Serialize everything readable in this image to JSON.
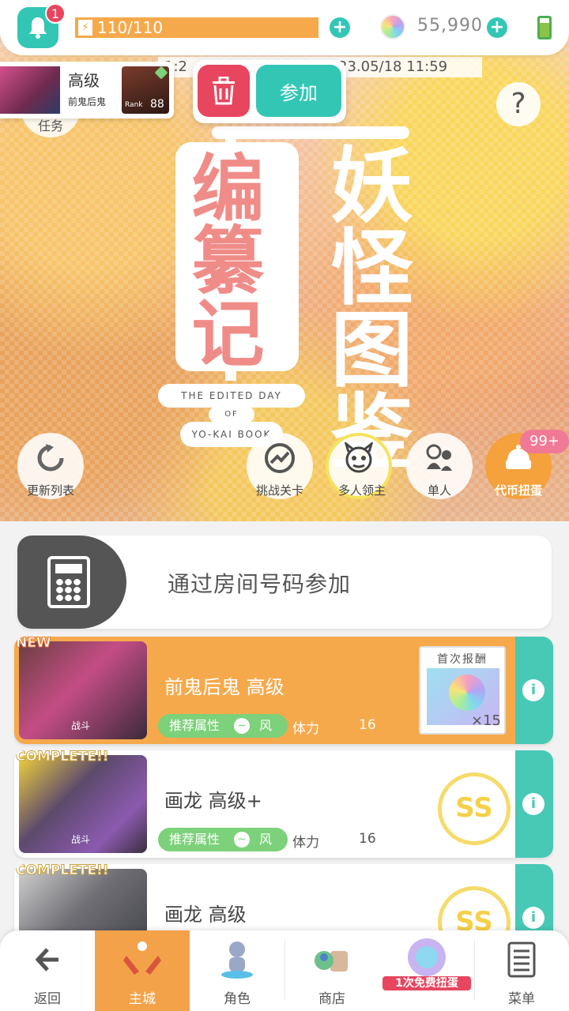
{
  "app": {
    "notifications": {
      "count": "1"
    },
    "stamina": {
      "text": "110/110"
    },
    "currency": {
      "amount": "55,990"
    },
    "ticker": {
      "left": "1:2",
      "right": "23.05/18 11:59"
    }
  },
  "quest_popup": {
    "title": "高级",
    "subtitle": "前鬼后鬼",
    "rank_label": "Rank",
    "rank": "88",
    "join_label": "参加"
  },
  "task": {
    "label": "任务"
  },
  "logo": {
    "left_chars": "编纂记",
    "right_chars": "妖怪图鉴",
    "en_line1": "THE EDITED DAY",
    "en_line2": "OF",
    "en_line3": "YO-KAI BOOK"
  },
  "modes": {
    "refresh": "更新列表",
    "challenge": "挑战关卡",
    "multi_boss": "多人领主",
    "solo": "单人",
    "gacha": "代币扭蛋",
    "gacha_badge": "99+"
  },
  "room_code": {
    "label": "通过房间号码参加"
  },
  "quests": [
    {
      "flag": "NEW",
      "thumb_label": "战斗",
      "title": "前鬼后鬼 高级",
      "attr_label": "推荐属性",
      "attr_value": "风",
      "stamina_label": "体力",
      "stamina_value": "16",
      "reward_label": "首次报酬",
      "reward_count": "×15"
    },
    {
      "flag": "COMPLETE!!",
      "thumb_label": "战斗",
      "title": "画龙 高级+",
      "attr_label": "推荐属性",
      "attr_value": "风",
      "stamina_label": "体力",
      "stamina_value": "16",
      "stamp": "SS"
    },
    {
      "flag": "COMPLETE!!",
      "title": "画龙 高级",
      "stamp": "SS"
    }
  ],
  "bottom_nav": {
    "back": "返回",
    "main": "主城",
    "character": "角色",
    "shop": "商店",
    "gacha_free": "1次免费扭蛋",
    "menu": "菜单"
  },
  "colors": {
    "accent": "#33c6b5",
    "danger": "#e8455e",
    "orange": "#f6a94b",
    "wind_green": "#7cd17a"
  }
}
